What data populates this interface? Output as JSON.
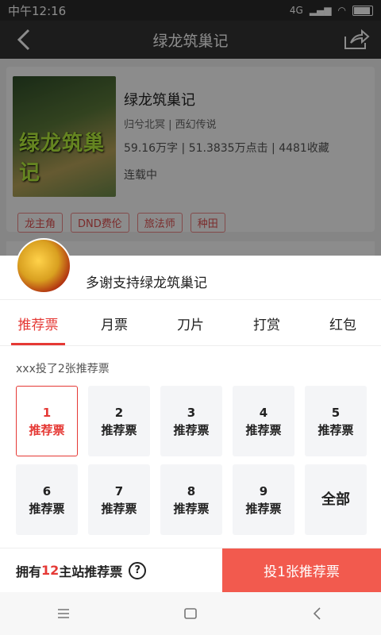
{
  "status": {
    "time": "中午12:16",
    "network": "4G"
  },
  "header": {
    "title": "绿龙筑巢记"
  },
  "book": {
    "cover_text": "绿龙筑巢记",
    "title": "绿龙筑巢记",
    "meta": "归兮北冥 | 西幻传说",
    "stats": "59.16万字 | 51.3835万点击 | 4481收藏",
    "status": "连载中",
    "tags": [
      "龙主角",
      "DND费伦",
      "旅法师",
      "种田"
    ]
  },
  "sheet": {
    "title": "多谢支持绿龙筑巢记",
    "tabs": [
      "推荐票",
      "月票",
      "刀片",
      "打赏",
      "红包"
    ],
    "info": "xxx投了2张推荐票",
    "options": [
      {
        "num": "1",
        "label": "推荐票"
      },
      {
        "num": "2",
        "label": "推荐票"
      },
      {
        "num": "3",
        "label": "推荐票"
      },
      {
        "num": "4",
        "label": "推荐票"
      },
      {
        "num": "5",
        "label": "推荐票"
      },
      {
        "num": "6",
        "label": "推荐票"
      },
      {
        "num": "7",
        "label": "推荐票"
      },
      {
        "num": "8",
        "label": "推荐票"
      },
      {
        "num": "9",
        "label": "推荐票"
      },
      {
        "all": "全部"
      }
    ],
    "owned_prefix": "拥有",
    "owned_count": "12",
    "owned_suffix": "主站推荐票",
    "help": "?",
    "vote_button": "投1张推荐票"
  },
  "colors": {
    "accent": "#e53935",
    "button": "#f25a4e"
  }
}
